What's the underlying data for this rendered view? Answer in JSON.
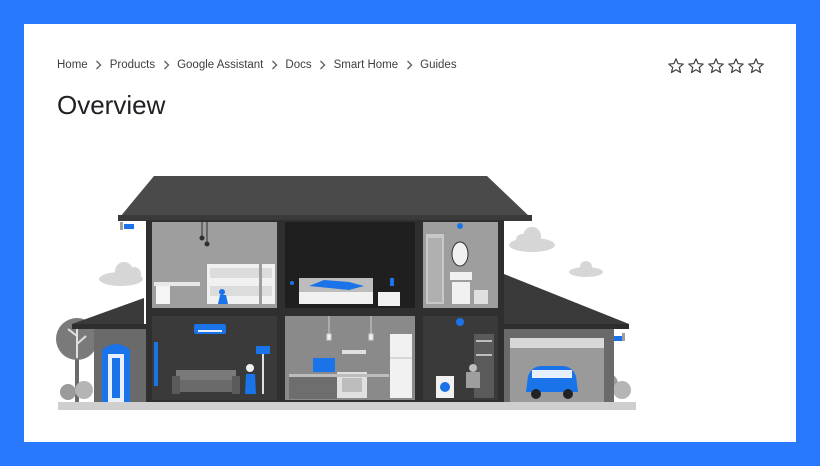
{
  "breadcrumb": {
    "items": [
      "Home",
      "Products",
      "Google Assistant",
      "Docs",
      "Smart Home",
      "Guides"
    ]
  },
  "page": {
    "title": "Overview"
  },
  "rating": {
    "stars_filled": 0,
    "stars_total": 5
  },
  "icons": {
    "separator": "chevron-right-icon",
    "star": "star-outline-icon",
    "illustration": "smart-home-house-illustration"
  },
  "colors": {
    "background": "#2979ff",
    "card": "#ffffff",
    "accent_blue": "#1a73e8",
    "house_dark": "#3c3c3c",
    "room_gray": "#8a8a8a"
  }
}
